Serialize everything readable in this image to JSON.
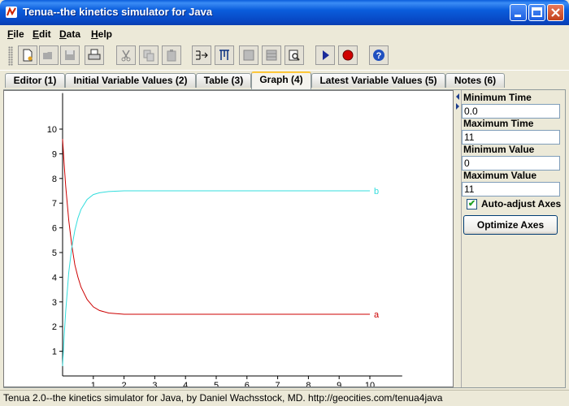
{
  "window": {
    "title": "Tenua--the kinetics simulator for Java"
  },
  "menu": [
    {
      "label": "File",
      "u": "F",
      "rest": "ile"
    },
    {
      "label": "Edit",
      "u": "E",
      "rest": "dit"
    },
    {
      "label": "Data",
      "u": "D",
      "rest": "ata"
    },
    {
      "label": "Help",
      "u": "H",
      "rest": "elp"
    }
  ],
  "toolbar": {
    "icons": [
      "new-file-icon",
      "open-folder-icon",
      "save-disk-icon",
      "print-icon",
      "cut-icon",
      "copy-icon",
      "paste-icon",
      "fit-icon",
      "tune-icon",
      "table-icon",
      "grid-icon",
      "inspect-icon",
      "run-icon",
      "stop-icon",
      "help-icon"
    ]
  },
  "tabs": [
    {
      "label": "Editor (1)",
      "active": false
    },
    {
      "label": "Initial Variable Values (2)",
      "active": false
    },
    {
      "label": "Table (3)",
      "active": false
    },
    {
      "label": "Graph (4)",
      "active": true
    },
    {
      "label": "Latest Variable Values (5)",
      "active": false
    },
    {
      "label": "Notes (6)",
      "active": false
    }
  ],
  "panel": {
    "min_time_label": "Minimum Time",
    "min_time": "0.0",
    "max_time_label": "Maximum Time",
    "max_time": "11",
    "min_value_label": "Minimum Value",
    "min_value": "0",
    "max_value_label": "Maximum Value",
    "max_value": "11",
    "auto_adjust_label": "Auto-adjust Axes",
    "auto_adjust": true,
    "optimize_label": "Optimize Axes"
  },
  "chart_data": {
    "type": "line",
    "xlim": [
      0,
      11
    ],
    "ylim": [
      0,
      11
    ],
    "x_ticks": [
      1,
      2,
      3,
      4,
      5,
      6,
      7,
      8,
      9,
      10
    ],
    "y_ticks": [
      1,
      2,
      3,
      4,
      5,
      6,
      7,
      8,
      9,
      10
    ],
    "grid": false,
    "series": [
      {
        "name": "a",
        "color": "#cc0000",
        "x": [
          0,
          0.05,
          0.1,
          0.2,
          0.3,
          0.4,
          0.5,
          0.6,
          0.8,
          1.0,
          1.2,
          1.5,
          2.0,
          3.0,
          5.0,
          7.0,
          10.0
        ],
        "y": [
          9.6,
          8.6,
          7.7,
          6.3,
          5.3,
          4.5,
          4.0,
          3.6,
          3.1,
          2.8,
          2.65,
          2.55,
          2.5,
          2.5,
          2.5,
          2.5,
          2.5
        ]
      },
      {
        "name": "b",
        "color": "#33dddd",
        "x": [
          0,
          0.05,
          0.1,
          0.2,
          0.3,
          0.4,
          0.5,
          0.6,
          0.8,
          1.0,
          1.2,
          1.5,
          2.0,
          3.0,
          5.0,
          7.0,
          10.0
        ],
        "y": [
          0.4,
          1.6,
          2.6,
          4.2,
          5.2,
          5.9,
          6.4,
          6.75,
          7.15,
          7.35,
          7.42,
          7.47,
          7.5,
          7.5,
          7.5,
          7.5,
          7.5
        ]
      }
    ]
  },
  "status": "Tenua 2.0--the kinetics simulator for Java, by Daniel Wachsstock, MD. http://geocities.com/tenua4java"
}
